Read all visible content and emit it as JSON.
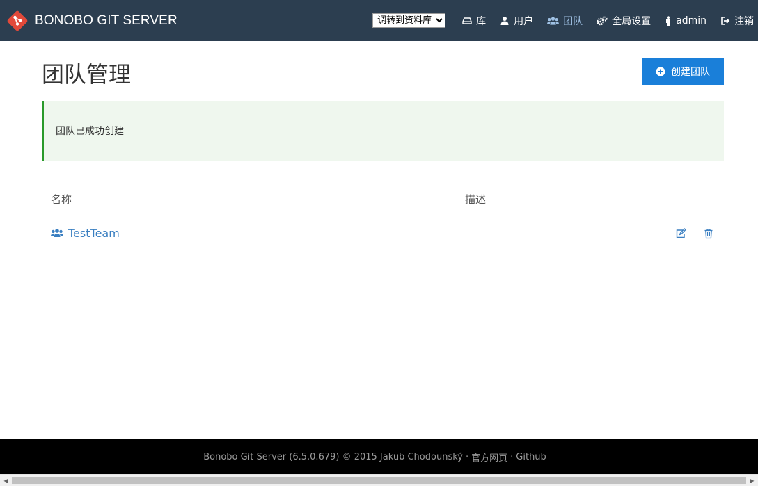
{
  "header": {
    "brand": "BONOBO GIT SERVER",
    "repo_select": {
      "selected": "调转到资料库"
    },
    "nav": [
      {
        "label": "库",
        "icon": "hdd-icon"
      },
      {
        "label": "用户",
        "icon": "user-icon"
      },
      {
        "label": "团队",
        "icon": "users-icon",
        "active": true
      },
      {
        "label": "全局设置",
        "icon": "gears-icon"
      },
      {
        "label": "admin",
        "icon": "person-icon"
      },
      {
        "label": "注销",
        "icon": "sign-out-icon"
      }
    ]
  },
  "main": {
    "title": "团队管理",
    "create_button": "创建团队",
    "alert": "团队已成功创建",
    "table": {
      "columns": [
        "名称",
        "描述"
      ],
      "rows": [
        {
          "name": "TestTeam",
          "description": ""
        }
      ]
    }
  },
  "footer": {
    "text": "Bonobo Git Server (6.5.0.679) © 2015 Jakub Chodounský",
    "sep1": "·",
    "official_link": "官方网页",
    "sep2": "·",
    "github_link": "Github"
  },
  "colors": {
    "topbar": "#2c3e50",
    "accent": "#1a7fd9",
    "link": "#3a7fc1",
    "alert_bg": "#eff7ee",
    "alert_border": "#2a9a2a",
    "footer_bg": "#000000",
    "logo": "#e2493a"
  }
}
